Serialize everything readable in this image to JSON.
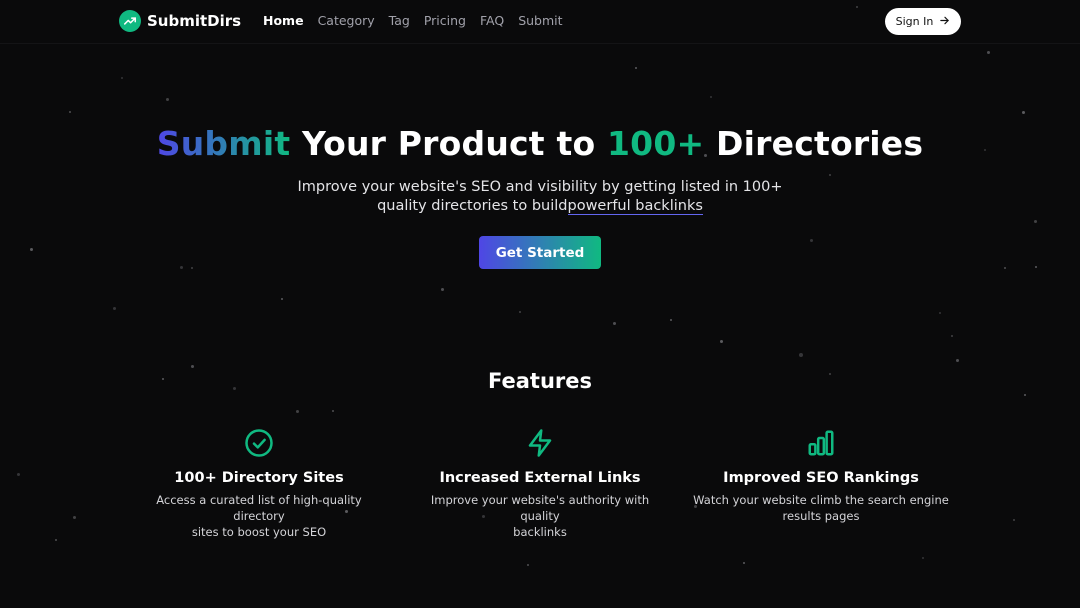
{
  "brand": {
    "name": "SubmitDirs",
    "logo_icon": "trending-up-icon",
    "accent": "#10b981"
  },
  "nav": {
    "items": [
      {
        "label": "Home",
        "active": true
      },
      {
        "label": "Category",
        "active": false
      },
      {
        "label": "Tag",
        "active": false
      },
      {
        "label": "Pricing",
        "active": false
      },
      {
        "label": "FAQ",
        "active": false
      },
      {
        "label": "Submit",
        "active": false
      }
    ],
    "signin_label": "Sign In",
    "signin_icon": "arrow-right-icon"
  },
  "hero": {
    "title_part1": "Submit",
    "title_part2": " Your Product to ",
    "title_part3": "100+",
    "title_part4": " Directories",
    "subtitle_line1": "Improve your website's SEO and visibility by getting listed in 100+",
    "subtitle_line2_a": "quality directories to build",
    "subtitle_line2_b": "powerful backlinks",
    "cta_label": "Get Started",
    "gradient_start": "#4f46e5",
    "gradient_end": "#10b981"
  },
  "features": {
    "title": "Features",
    "items": [
      {
        "icon": "check-circle-icon",
        "title": "100+ Directory Sites",
        "line1": "Access a curated list of high-quality directory",
        "line2": "sites to boost your SEO"
      },
      {
        "icon": "lightning-icon",
        "title": "Increased External Links",
        "line1": "Improve your website's authority with quality",
        "line2": "backlinks"
      },
      {
        "icon": "bar-chart-icon",
        "title": "Improved SEO Rankings",
        "line1": "Watch your website climb the search engine",
        "line2": "results pages"
      }
    ]
  }
}
